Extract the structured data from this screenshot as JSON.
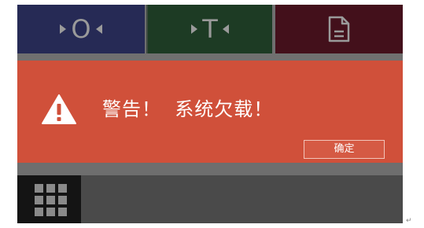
{
  "topbar": {
    "zero": {
      "label": "O",
      "icon": "zero-icon",
      "color": "#262a55"
    },
    "tare": {
      "label": "T",
      "icon": "tare-icon",
      "color": "#1d3b24"
    },
    "doc": {
      "icon": "document-icon",
      "color": "#43101b"
    }
  },
  "alert": {
    "icon": "warning-icon",
    "message": "警告！  系统欠载！",
    "ok_label": "确定",
    "background": "#d0503a"
  },
  "bottombar": {
    "apps_icon": "apps-grid-icon"
  },
  "colors": {
    "accent_alert": "#d0503a",
    "screen_bg": "#6f6f6f",
    "bottom_bg": "#4a4a4a"
  }
}
